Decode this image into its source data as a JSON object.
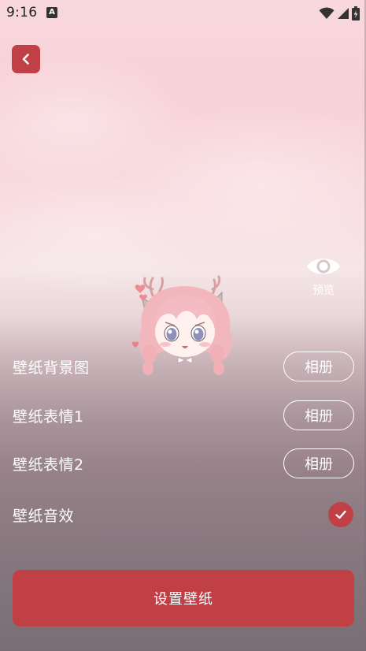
{
  "status_bar": {
    "time": "9:16",
    "notification_icon": "a-notification-icon",
    "icons": [
      "wifi-icon",
      "signal-icon",
      "battery-icon"
    ]
  },
  "header": {
    "back_icon": "chevron-left-icon"
  },
  "preview": {
    "icon": "eye-icon",
    "label": "预览"
  },
  "rows": [
    {
      "label": "壁纸背景图",
      "action": "相册"
    },
    {
      "label": "壁纸表情1",
      "action": "相册"
    },
    {
      "label": "壁纸表情2",
      "action": "相册"
    },
    {
      "label": "壁纸音效",
      "checked": true
    }
  ],
  "primary_action": {
    "label": "设置壁纸"
  },
  "colors": {
    "accent": "#c04046",
    "text_light": "#ffffff",
    "status_text": "#222222"
  }
}
